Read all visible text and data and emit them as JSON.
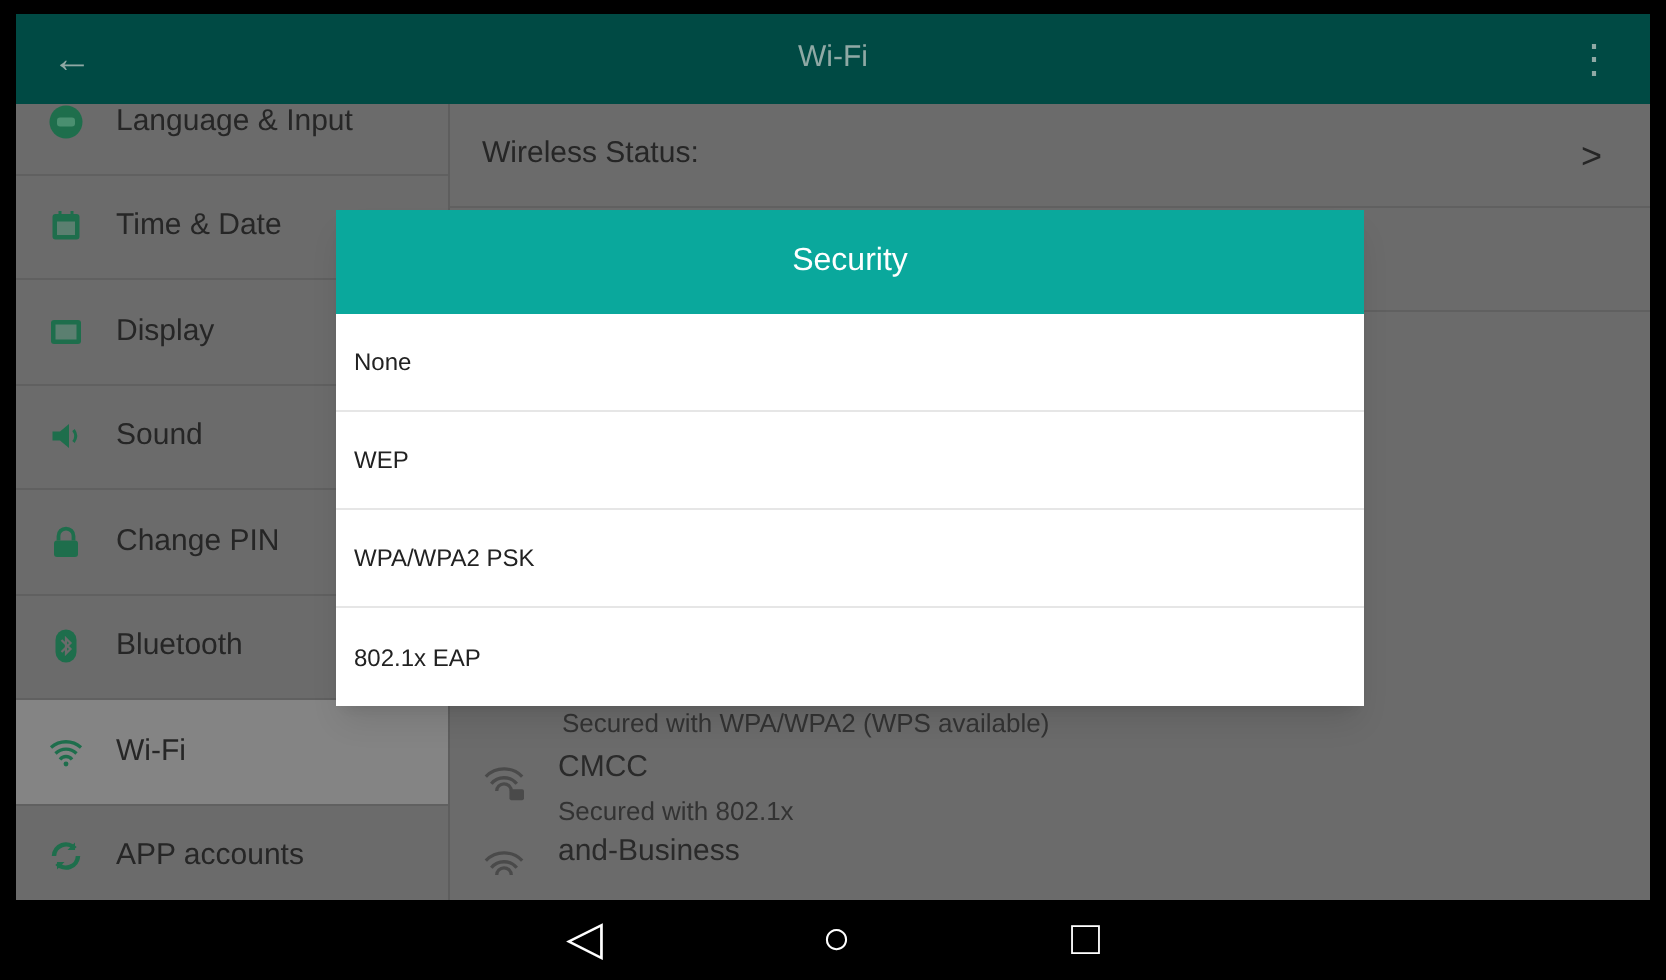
{
  "header": {
    "back": "←",
    "title": "Wi-Fi",
    "menu": "⋮"
  },
  "sidebar": {
    "items": [
      {
        "label": "Language & Input",
        "kind": "language",
        "selected": false
      },
      {
        "label": "Time & Date",
        "kind": "calendar",
        "selected": false
      },
      {
        "label": "Display",
        "kind": "display",
        "selected": false
      },
      {
        "label": "Sound",
        "kind": "sound",
        "selected": false
      },
      {
        "label": "Change PIN",
        "kind": "lock",
        "selected": false
      },
      {
        "label": "Bluetooth",
        "kind": "bluetooth",
        "selected": false
      },
      {
        "label": "Wi-Fi",
        "kind": "wifi",
        "selected": true
      },
      {
        "label": "APP accounts",
        "kind": "sync",
        "selected": false
      }
    ]
  },
  "content": {
    "wireless_status": "Wireless Status:",
    "chevron": ">",
    "partial_subtitle": "Secured with WPA/WPA2 (WPS available)",
    "networks": [
      {
        "name": "CMCC",
        "subtitle": "Secured with 802.1x",
        "locked": true
      },
      {
        "name": "and-Business",
        "locked": false
      }
    ]
  },
  "dialog": {
    "title": "Security",
    "options": [
      "None",
      "WEP",
      "WPA/WPA2 PSK",
      "802.1x EAP"
    ]
  },
  "nav": {
    "back": "◁",
    "home": "○",
    "recent": "□"
  }
}
